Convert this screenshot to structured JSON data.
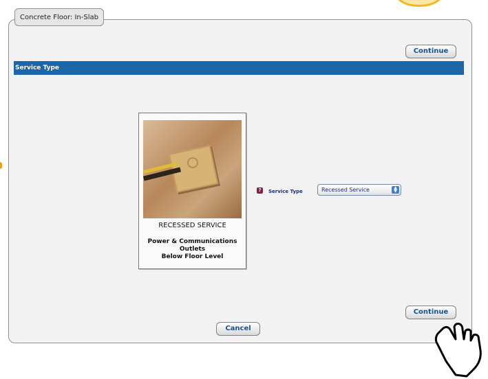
{
  "panel": {
    "tab_label": "Concrete Floor: In-Slab"
  },
  "buttons": {
    "continue_top": "Continue",
    "continue_bottom": "Continue",
    "cancel": "Cancel"
  },
  "section": {
    "title": "Service Type"
  },
  "option_card": {
    "title": "RECESSED SERVICE",
    "description": "Power & Communications\nOutlets\nBelow Floor Level"
  },
  "service_type_field": {
    "label": "Service Type",
    "selected_value": "Recessed Service"
  },
  "colors": {
    "section_bar": "#1a66a8",
    "button_text": "#1b4f8f",
    "help_icon": "#8e1c3b"
  }
}
